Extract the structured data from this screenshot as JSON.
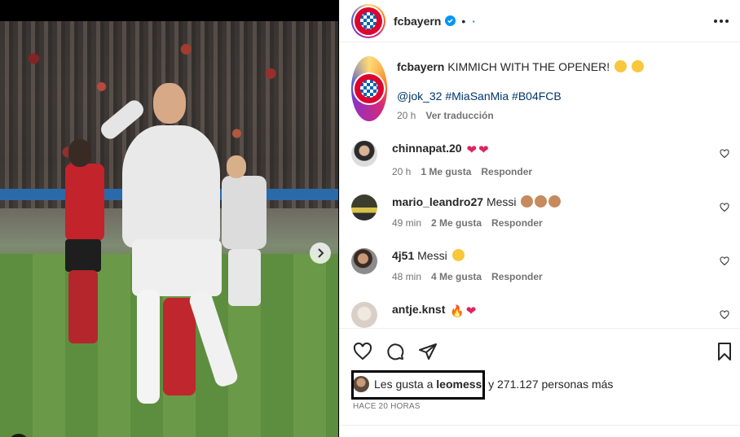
{
  "post": {
    "username": "fcbayern",
    "follow_label": "·",
    "dot": "•"
  },
  "caption": {
    "username": "fcbayern",
    "text": "KIMMICH WITH THE OPENER!",
    "tags": "@jok_32 #MiaSanMia #B04FCB",
    "time": "20 h",
    "translate": "Ver traducción"
  },
  "comments": [
    {
      "username": "chinnapat.20",
      "text": "",
      "time": "20 h",
      "likes": "1 Me gusta",
      "reply": "Responder",
      "emoji": [
        "heart",
        "heart"
      ]
    },
    {
      "username": "mario_leandro27",
      "text": "Messi",
      "time": "49 min",
      "likes": "2 Me gusta",
      "reply": "Responder",
      "emoji": [
        "skin",
        "skin",
        "skin"
      ]
    },
    {
      "username": "4j51",
      "text": "Messi",
      "time": "48 min",
      "likes": "4 Me gusta",
      "reply": "Responder",
      "emoji": [
        "yellow"
      ]
    },
    {
      "username": "antje.knst",
      "text": "",
      "time": "",
      "likes": "",
      "reply": "",
      "emoji": [
        "fire",
        "heart"
      ]
    }
  ],
  "likes": {
    "prefix": "Les gusta a",
    "user": "leomessi",
    "suffix": "y 271.127 personas más"
  },
  "posted": "HACE 20 HORAS",
  "colors": {
    "accent": "#0095f6",
    "brand": "#dc052d",
    "meta": "#737373"
  }
}
